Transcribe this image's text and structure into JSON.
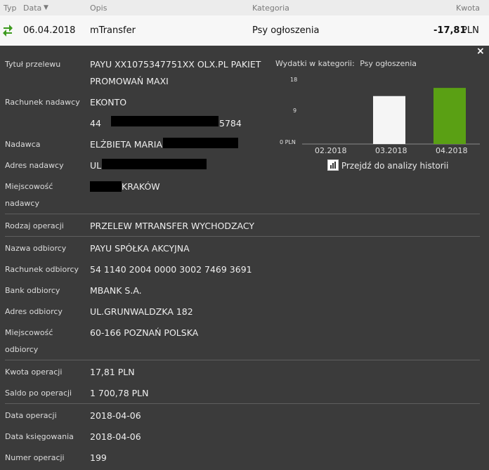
{
  "header": {
    "typ": "Typ",
    "data": "Data",
    "sort_icon": "▼",
    "opis": "Opis",
    "kategoria": "Kategoria",
    "kwota": "Kwota"
  },
  "transaction": {
    "date": "06.04.2018",
    "description": "mTransfer",
    "category": "Psy ogłoszenia",
    "amount": "-17,81",
    "currency": "PLN",
    "type_icon": "transfer-arrows-icon"
  },
  "details": {
    "tytul": {
      "label": "Tytuł przelewu",
      "line1": "PAYU XX1075347751XX OLX.PL PAKIET",
      "line2": "PROMOWAŃ MAXI"
    },
    "rach_nad": {
      "label": "Rachunek nadawcy",
      "line1": "EKONTO",
      "prefix": "44",
      "suffix": "5784"
    },
    "nadawca": {
      "label": "Nadawca",
      "value": "ELŻBIETA MARIA I"
    },
    "adres_nad": {
      "label": "Adres nadawcy",
      "value": "UL."
    },
    "miejsc_nad": {
      "label1": "Miejscowość",
      "label2": "nadawcy",
      "value": "KRAKÓW"
    },
    "rodzaj": {
      "label": "Rodzaj operacji",
      "value": "PRZELEW MTRANSFER WYCHODZACY"
    },
    "nazwa_odb": {
      "label": "Nazwa odbiorcy",
      "value": "PAYU SPÓŁKA AKCYJNA"
    },
    "rach_odb": {
      "label": "Rachunek odbiorcy",
      "value": "54 1140 2004 0000 3002 7469 3691"
    },
    "bank_odb": {
      "label": "Bank odbiorcy",
      "value": "MBANK S.A."
    },
    "adres_odb": {
      "label": "Adres odbiorcy",
      "value": "UL.GRUNWALDZKA 182"
    },
    "miejsc_odb": {
      "label1": "Miejscowość",
      "label2": "odbiorcy",
      "value": "60-166 POZNAŃ POLSKA"
    },
    "kwota": {
      "label": "Kwota operacji",
      "value": "17,81 PLN"
    },
    "saldo": {
      "label": "Saldo po operacji",
      "value": "1 700,78 PLN"
    },
    "data_op": {
      "label": "Data operacji",
      "value": "2018-04-06"
    },
    "data_ks": {
      "label": "Data księgowania",
      "value": "2018-04-06"
    },
    "numer": {
      "label": "Numer operacji",
      "value": "199"
    }
  },
  "chart_panel": {
    "title": "Wydatki w kategorii:",
    "category": "Psy ogłoszenia",
    "link": "Przejdź do analizy historii",
    "close": "×"
  },
  "chart_data": {
    "type": "bar",
    "categories": [
      "02.2018",
      "03.2018",
      "04.2018"
    ],
    "values": [
      0,
      13.5,
      15.8
    ],
    "highlight_index": 2,
    "yticks": [
      "18",
      "9",
      "0 PLN"
    ],
    "ylim": [
      0,
      18
    ],
    "colors": {
      "default": "#f5f5f5",
      "highlight": "#5aa014"
    }
  }
}
